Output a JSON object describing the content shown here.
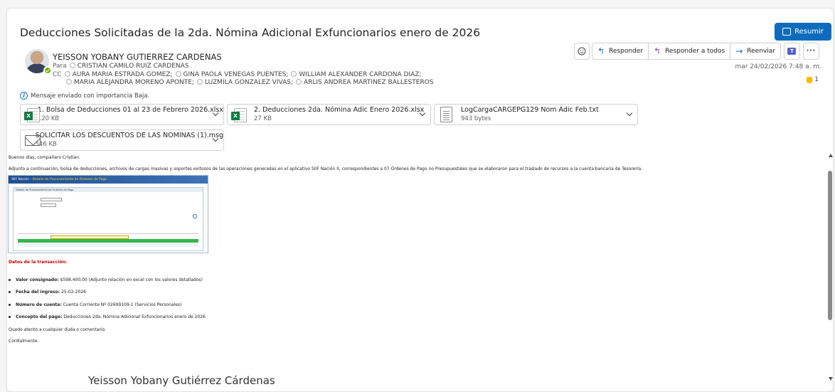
{
  "message": {
    "subject": "Deducciones Solicitadas de la 2da. Nómina Adicional Exfuncionarios enero de 2026",
    "sender": "YEISSON YOBANY GUTIERREZ CARDENAS",
    "to_label": "Para",
    "to": [
      "CRISTIAN CAMILO RUIZ CARDENAS"
    ],
    "cc_label": "CC",
    "cc_line1": [
      "AURA MARIA ESTRADA GOMEZ;",
      "GINA PAOLA VENEGAS PUENTES;",
      "WILLIAM ALEXANDER CARDONA DIAZ;"
    ],
    "cc_line2": [
      "MARIA ALEJANDRA MORENO APONTE;",
      "LUZMILA GONZALEZ VIVAS;",
      "ARLIS ANDREA MARTINEZ BALLESTEROS"
    ],
    "importance": "Mensaje enviado con importancia Baja.",
    "date": "mar 24/02/2026 7:48 a. m.",
    "reaction_count": "1"
  },
  "actions": {
    "resumir": "Resumir",
    "responder": "Responder",
    "responder_todos": "Responder a todos",
    "reenviar": "Reenviar",
    "more": "···"
  },
  "attachments": [
    {
      "name": "1. Bolsa de Deducciones 01 al 23 de Febrero 2026.xlsx",
      "size": "120 KB",
      "type": "excel-icon"
    },
    {
      "name": "2. Deducciones 2da. Nómina Adic Enero 2026.xlsx",
      "size": "27 KB",
      "type": "excel-icon"
    },
    {
      "name": "LogCargaCARGEPG129 Nom Adic Feb.txt",
      "size": "943 bytes",
      "type": "text-file-icon"
    },
    {
      "name": "SOLICITAR LOS DESCUENTOS DE LAS NOMINAS (1).msg",
      "size": "546 KB",
      "type": "mail-icon"
    }
  ],
  "body": {
    "greeting": "Buenos días, compañero Cristian.",
    "intro": "Adjunto a continuación, bolsa de deducciones, archivos de cargas masivas y soportes exitosos de las operaciones generadas en el aplicativo SIIF Nación II, correspondientes a 07 Órdenes de Pago no Presupuestales que se elaboraron para el traslado de recursos a la cuenta bancaria de Tesorería.",
    "shot_header_a": "SIIF Nación - ",
    "shot_header_b": "Detalle de Procesamiento de Órdenes de Pago",
    "shot_caption": "Detalle de Procesamiento de Órdenes de Pago",
    "section_title": "Datos de la transacción:",
    "items": [
      {
        "label": "Valor consignado:",
        "value": "$598.400,00 (Adjunto relación en excel con los valores detallados)"
      },
      {
        "label": "Fecha del ingreso:",
        "value": "25-02-2026"
      },
      {
        "label": "Número de cuenta:",
        "value": "Cuenta Corriente Nº 02699109-1 (Servicios Personales)"
      },
      {
        "label": "Concepto del pago:",
        "value": "Deducciones 2da. Nómina Adicional Exfuncionarios enero de 2026"
      }
    ],
    "closing1": "Quedo atento a cualquier duda o comentario.",
    "closing2": "Cordialmente.",
    "signature": "Yeisson Yobany Gutiérrez Cárdenas"
  }
}
